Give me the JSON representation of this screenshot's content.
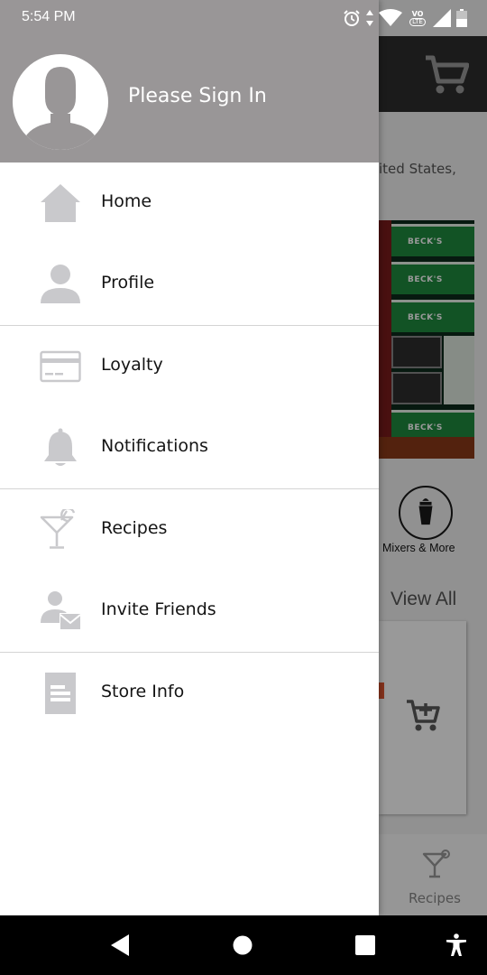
{
  "status_bar": {
    "time": "5:54 PM",
    "icons": [
      "alarm-icon",
      "data-arrows-icon",
      "wifi-icon",
      "volte-icon",
      "signal-icon",
      "battery-icon"
    ],
    "volte_top": "VO",
    "volte_bottom": "LTE"
  },
  "background": {
    "location_text": "ited States,",
    "banner_brand": "BECK'S",
    "category_label": "Mixers & More",
    "view_all": "View All",
    "tab_label": "Recipes"
  },
  "drawer": {
    "header": {
      "signin_label": "Please Sign In",
      "background": "#999697"
    },
    "sections": [
      [
        {
          "label": "Home",
          "icon": "home-icon"
        },
        {
          "label": "Profile",
          "icon": "person-icon"
        }
      ],
      [
        {
          "label": "Loyalty",
          "icon": "credit-card-icon"
        },
        {
          "label": "Notifications",
          "icon": "bell-icon"
        }
      ],
      [
        {
          "label": "Recipes",
          "icon": "cocktail-icon"
        },
        {
          "label": "Invite Friends",
          "icon": "invite-friends-icon"
        }
      ],
      [
        {
          "label": "Store Info",
          "icon": "document-icon"
        }
      ]
    ],
    "icon_color": "#c9c9cc"
  },
  "nav_bar": {
    "buttons": [
      "back-icon",
      "home-circle-icon",
      "recents-icon",
      "accessibility-icon"
    ]
  }
}
